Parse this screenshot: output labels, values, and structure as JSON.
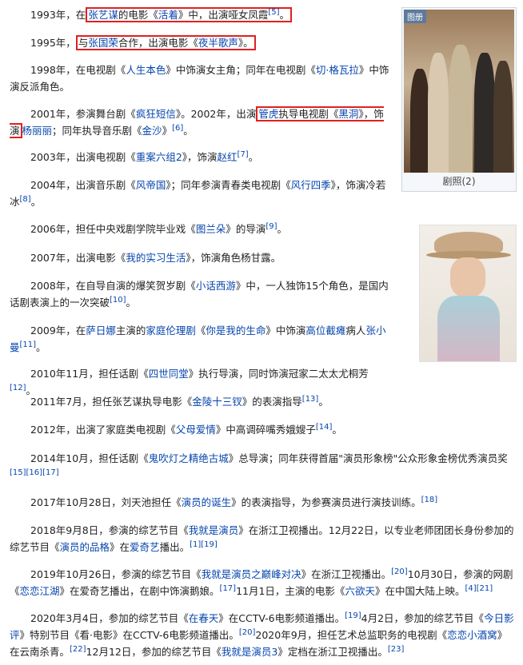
{
  "gallery": {
    "badge": "图册",
    "caption": "剧照(2)"
  },
  "p1993": {
    "year": "1993年，在",
    "director": "张艺谋",
    "mid": "的电影《",
    "film": "活着",
    "post": "》中，出演哑女凤霞",
    "ref": "[5]",
    "end": "。"
  },
  "p1995": {
    "pre": "与",
    "actor": "张国荣",
    "mid": "合作，出演电影《",
    "film": "夜半歌声",
    "post": "》。",
    "year": "1995年，"
  },
  "p1998": {
    "a": "1998年，在电视剧《",
    "b": "人生本色",
    "c": "》中饰演女主角；同年在电视剧《",
    "d": "切·格瓦拉",
    "e": "》中饰演反派角色。"
  },
  "p2001": {
    "a": "2001年，参演舞台剧《",
    "b": "疯狂短信",
    "c": "》。2002年，出演",
    "d": "管虎",
    "e": "执导电视剧《",
    "f": "黑洞",
    "g": "》，饰演",
    "h": "杨丽丽",
    "i": "；同年执导音乐剧《",
    "j": "金沙",
    "k": "》",
    "ref": "[6]",
    "l": "。"
  },
  "p2003": {
    "a": "2003年，出演电视剧《",
    "b": "重案六组2",
    "c": "》，饰演",
    "d": "赵红",
    "ref": "[7]",
    "e": "。"
  },
  "p2004": {
    "a": "2004年，出演音乐剧《",
    "b": "风帝国",
    "c": "》；同年参演青春类电视剧《",
    "d": "风行四季",
    "e": "》，饰演冷若冰",
    "ref": "[8]",
    "f": "。"
  },
  "p2006": {
    "a": "2006年，担任中央戏剧学院毕业戏《",
    "b": "图兰朵",
    "c": "》的导演",
    "ref": "[9]",
    "d": "。"
  },
  "p2007": {
    "a": "2007年，出演电影《",
    "b": "我的实习生活",
    "c": "》，饰演角色杨甘露。"
  },
  "p2008": {
    "a": "2008年，在自导自演的爆笑贺岁剧《",
    "b": "小话西游",
    "c": "》中，一人独饰15个角色，是国内话剧表演上的一次突破",
    "ref": "[10]",
    "d": "。"
  },
  "p2009": {
    "a": "2009年，在",
    "b": "萨日娜",
    "c": "主演的",
    "d": "家庭伦理剧",
    "e": "《",
    "f": "你是我的生命",
    "g": "》中饰演",
    "h": "高位截瘫",
    "i": "病人",
    "j": "张小曼",
    "ref": "[11]",
    "k": "。"
  },
  "p2010": {
    "a": "2010年11月，担任话剧《",
    "b": "四世同堂",
    "c": "》执行导演，同时饰演冠家二太太尤桐芳",
    "ref": "[12]",
    "d": "。"
  },
  "p2011": {
    "a": "2011年7月，担任张艺谋执导电影《",
    "b": "金陵十三钗",
    "c": "》的表演指导",
    "ref": "[13]",
    "d": "。"
  },
  "p2012": {
    "a": "2012年，出演了家庭类电视剧《",
    "b": "父母爱情",
    "c": "》中高调碎嘴秀娥嫂子",
    "ref": "[14]",
    "d": "。"
  },
  "p2014": {
    "a": "2014年10月，担任话剧《",
    "b": "鬼吹灯之精绝古城",
    "c": "》总导演；同年获得首届\"演员形象榜\"公众形象金榜优秀演员奖",
    "r1": "[15]",
    "r2": "[16]",
    "r3": "[17]"
  },
  "p2017": {
    "a": "2017年10月28日，刘天池担任《",
    "b": "演员的诞生",
    "c": "》的表演指导，为参赛演员进行演技训练。",
    "ref": "[18]"
  },
  "p2018": {
    "a": "2018年9月8日，参演的综艺节目《",
    "b": "我就是演员",
    "c": "》在浙江卫视播出。12月22日，以专业老师团团长身份参加的综艺节目《",
    "d": "演员的品格",
    "e": "》在",
    "f": "爱奇艺",
    "g": "播出。",
    "r1": "[1]",
    "r2": "[19]"
  },
  "p2019": {
    "a": "2019年10月26日，参演的综艺节目《",
    "b": "我就是演员之巅峰对决",
    "c": "》在浙江卫视播出。",
    "r1": "[20]",
    "d": "10月30日，参演的网剧《",
    "e": "恋恋江湖",
    "f": "》在爱奇艺播出，在剧中饰演鹅娘。",
    "r2": "[17]",
    "g": "11月1日，主演的电影《",
    "h": "六欲天",
    "i": "》在中国大陆上映。",
    "r3": "[4]",
    "r4": "[21]"
  },
  "p2020": {
    "a": "2020年3月4日，参加的综艺节目《",
    "b": "在春天",
    "c": "》在CCTV-6电影频道播出。",
    "r1": "[19]",
    "d": "4月2日，参加的综艺节目《",
    "e": "今日影评",
    "f": "》特别节目《看·电影》在CCTV-6电影频道播出。",
    "r2": "[20]",
    "g": "2020年9月，担任艺术总监职务的电视剧《",
    "h": "恋恋小酒窝",
    "i": "》在云南杀青。",
    "r3": "[22]",
    "j": "12月12日，参加的综艺节目《",
    "k": "我就是演员3",
    "l": "》定档在浙江卫视播出。",
    "r4": "[23]"
  }
}
